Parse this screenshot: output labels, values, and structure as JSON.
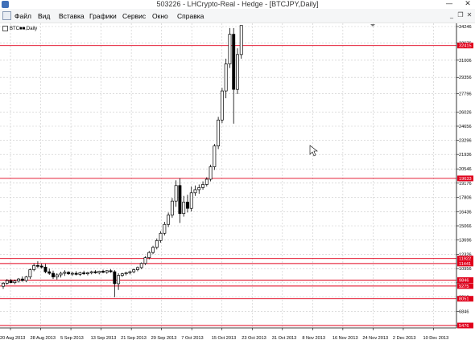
{
  "window": {
    "title": "503226 - LHCrypto-Real - Hedge - [BTCJPY,Daily]",
    "minimize_glyph": "—",
    "close_glyph": "✕"
  },
  "menu": {
    "items": [
      "Файл",
      "Вид",
      "Вставка",
      "Графики",
      "Сервис",
      "Окно",
      "Справка"
    ]
  },
  "chart_label": "BTC■■,Daily",
  "chart_data": {
    "type": "candlestick",
    "symbol": "BTCJPY",
    "timeframe": "Daily",
    "colors": {
      "candle": "#000000",
      "level_line": "#e0001b",
      "tag_bg": "#e0001b",
      "grid": "#c9c9c9"
    },
    "y_ticks": [
      34246,
      32676,
      31006,
      29356,
      27796,
      26026,
      24656,
      23296,
      21936,
      20546,
      19176,
      17806,
      16436,
      15066,
      13696,
      12326,
      10956,
      9586,
      8216,
      6846,
      5476
    ],
    "x_ticks": [
      "20 Aug 2013",
      "28 Aug 2013",
      "5 Sep 2013",
      "13 Sep 2013",
      "21 Sep 2013",
      "29 Sep 2013",
      "7 Oct 2013",
      "15 Oct 2013",
      "23 Oct 2013",
      "31 Oct 2013",
      "8 Nov 2013",
      "16 Nov 2013",
      "24 Nov 2013",
      "2 Dec 2013",
      "10 Dec 2013"
    ],
    "horizontal_levels": [
      32415,
      19633,
      11922,
      11441,
      9846,
      9275,
      8051,
      5476
    ],
    "level_tags": [
      {
        "value": 32415,
        "text": "32415"
      },
      {
        "value": 19633,
        "text": "19633"
      },
      {
        "value": 11922,
        "text": "11922"
      },
      {
        "value": 11441,
        "text": "11441"
      },
      {
        "value": 9846,
        "text": "9846"
      },
      {
        "value": 9275,
        "text": "9275"
      },
      {
        "value": 8051,
        "text": "8051"
      },
      {
        "value": 5476,
        "text": "5476"
      }
    ],
    "candles": [
      {
        "o": 9250,
        "h": 9650,
        "l": 9000,
        "c": 9550
      },
      {
        "o": 9550,
        "h": 9950,
        "l": 9400,
        "c": 9800
      },
      {
        "o": 9800,
        "h": 9950,
        "l": 9550,
        "c": 9600
      },
      {
        "o": 9600,
        "h": 9900,
        "l": 9450,
        "c": 9750
      },
      {
        "o": 9750,
        "h": 10050,
        "l": 9600,
        "c": 9950
      },
      {
        "o": 9950,
        "h": 10200,
        "l": 9700,
        "c": 9800
      },
      {
        "o": 9800,
        "h": 10250,
        "l": 9650,
        "c": 10150
      },
      {
        "o": 10150,
        "h": 10950,
        "l": 9950,
        "c": 10850
      },
      {
        "o": 10850,
        "h": 11450,
        "l": 10700,
        "c": 11250
      },
      {
        "o": 11250,
        "h": 11650,
        "l": 11000,
        "c": 11200
      },
      {
        "o": 11200,
        "h": 11450,
        "l": 10950,
        "c": 11100
      },
      {
        "o": 11100,
        "h": 11400,
        "l": 10500,
        "c": 10650
      },
      {
        "o": 10650,
        "h": 10950,
        "l": 10350,
        "c": 10500
      },
      {
        "o": 10500,
        "h": 10750,
        "l": 9950,
        "c": 10150
      },
      {
        "o": 10150,
        "h": 10500,
        "l": 9900,
        "c": 10350
      },
      {
        "o": 10350,
        "h": 10650,
        "l": 10100,
        "c": 10500
      },
      {
        "o": 10500,
        "h": 10800,
        "l": 10250,
        "c": 10600
      },
      {
        "o": 10600,
        "h": 10700,
        "l": 10350,
        "c": 10450
      },
      {
        "o": 10450,
        "h": 10650,
        "l": 10250,
        "c": 10500
      },
      {
        "o": 10500,
        "h": 10700,
        "l": 10300,
        "c": 10400
      },
      {
        "o": 10400,
        "h": 10650,
        "l": 10250,
        "c": 10550
      },
      {
        "o": 10550,
        "h": 10750,
        "l": 10350,
        "c": 10450
      },
      {
        "o": 10450,
        "h": 10650,
        "l": 10300,
        "c": 10550
      },
      {
        "o": 10550,
        "h": 10750,
        "l": 10400,
        "c": 10650
      },
      {
        "o": 10650,
        "h": 10800,
        "l": 10450,
        "c": 10550
      },
      {
        "o": 10550,
        "h": 10750,
        "l": 10400,
        "c": 10700
      },
      {
        "o": 10700,
        "h": 10850,
        "l": 10500,
        "c": 10600
      },
      {
        "o": 10600,
        "h": 10800,
        "l": 10450,
        "c": 10750
      },
      {
        "o": 10750,
        "h": 10900,
        "l": 10550,
        "c": 10650
      },
      {
        "o": 10650,
        "h": 10800,
        "l": 8200,
        "c": 9500
      },
      {
        "o": 9500,
        "h": 10500,
        "l": 8900,
        "c": 10300
      },
      {
        "o": 10300,
        "h": 10550,
        "l": 10150,
        "c": 10450
      },
      {
        "o": 10450,
        "h": 10650,
        "l": 10300,
        "c": 10550
      },
      {
        "o": 10550,
        "h": 10750,
        "l": 10400,
        "c": 10650
      },
      {
        "o": 10650,
        "h": 10950,
        "l": 10500,
        "c": 10850
      },
      {
        "o": 10850,
        "h": 11150,
        "l": 10700,
        "c": 11050
      },
      {
        "o": 11050,
        "h": 11550,
        "l": 10900,
        "c": 11450
      },
      {
        "o": 11450,
        "h": 12150,
        "l": 11300,
        "c": 12000
      },
      {
        "o": 12000,
        "h": 12650,
        "l": 11850,
        "c": 12500
      },
      {
        "o": 12500,
        "h": 13150,
        "l": 12350,
        "c": 13000
      },
      {
        "o": 13000,
        "h": 13850,
        "l": 12800,
        "c": 13650
      },
      {
        "o": 13650,
        "h": 14550,
        "l": 13450,
        "c": 14350
      },
      {
        "o": 14350,
        "h": 15450,
        "l": 14150,
        "c": 15200
      },
      {
        "o": 15200,
        "h": 16350,
        "l": 14950,
        "c": 16100
      },
      {
        "o": 16100,
        "h": 17750,
        "l": 15850,
        "c": 17450
      },
      {
        "o": 17450,
        "h": 19450,
        "l": 16900,
        "c": 18950
      },
      {
        "o": 18950,
        "h": 19650,
        "l": 15350,
        "c": 16250
      },
      {
        "o": 16250,
        "h": 17950,
        "l": 15950,
        "c": 17350
      },
      {
        "o": 17350,
        "h": 18050,
        "l": 16350,
        "c": 16750
      },
      {
        "o": 16750,
        "h": 18850,
        "l": 16450,
        "c": 18250
      },
      {
        "o": 18250,
        "h": 18950,
        "l": 17950,
        "c": 18550
      },
      {
        "o": 18550,
        "h": 19050,
        "l": 18150,
        "c": 18750
      },
      {
        "o": 18750,
        "h": 19350,
        "l": 18550,
        "c": 19050
      },
      {
        "o": 19050,
        "h": 19750,
        "l": 18850,
        "c": 19550
      },
      {
        "o": 19550,
        "h": 20950,
        "l": 19350,
        "c": 20750
      },
      {
        "o": 20750,
        "h": 22950,
        "l": 20450,
        "c": 22750
      },
      {
        "o": 22750,
        "h": 25550,
        "l": 22450,
        "c": 25250
      },
      {
        "o": 25250,
        "h": 28350,
        "l": 24950,
        "c": 28050
      },
      {
        "o": 28050,
        "h": 31150,
        "l": 27350,
        "c": 30650
      },
      {
        "o": 30650,
        "h": 34100,
        "l": 30250,
        "c": 33500
      },
      {
        "o": 33500,
        "h": 34100,
        "l": 24900,
        "c": 28200
      },
      {
        "o": 28200,
        "h": 32150,
        "l": 27750,
        "c": 31550
      },
      {
        "o": 31550,
        "h": 34350,
        "l": 31150,
        "c": 34350
      }
    ]
  }
}
